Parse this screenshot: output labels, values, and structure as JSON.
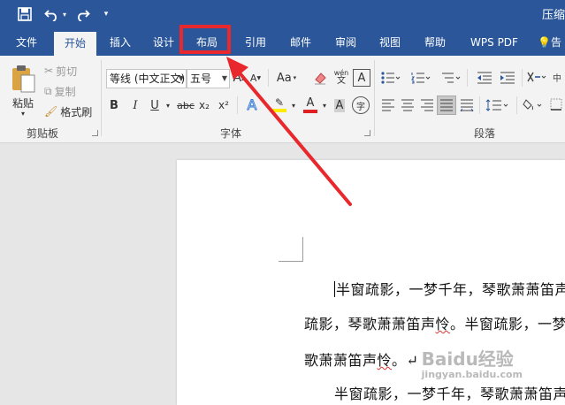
{
  "quick_access": {
    "save_icon": "save-icon",
    "undo_icon": "undo-icon",
    "redo_icon": "redo-icon",
    "customize_icon": "customize-icon"
  },
  "window": {
    "doc_title": "压缩"
  },
  "tabs": [
    {
      "label": "文件"
    },
    {
      "label": "开始"
    },
    {
      "label": "插入"
    },
    {
      "label": "设计"
    },
    {
      "label": "布局"
    },
    {
      "label": "引用"
    },
    {
      "label": "邮件"
    },
    {
      "label": "审阅"
    },
    {
      "label": "视图"
    },
    {
      "label": "帮助"
    },
    {
      "label": "WPS PDF"
    },
    {
      "label": "告"
    }
  ],
  "ribbon": {
    "clipboard": {
      "paste": "粘贴",
      "cut": "剪切",
      "copy": "复制",
      "format_painter": "格式刷",
      "group_label": "剪贴板"
    },
    "font": {
      "font_name": "等线 (中文正文)",
      "font_size": "五号",
      "grow_font": "A",
      "shrink_font": "A",
      "change_case": "Aa",
      "phonetic": "wén",
      "border_char": "A",
      "bold": "B",
      "italic": "I",
      "underline": "U",
      "strike": "abc",
      "subscript": "x₂",
      "superscript": "x²",
      "text_effect": "A",
      "font_color": "A",
      "enclose": "字",
      "group_label": "字体"
    },
    "paragraph": {
      "group_label": "段落"
    }
  },
  "document": {
    "lines": [
      "半窗疏影，一梦千年，琴歌萧萧笛声",
      [
        "疏影，琴歌萧萧笛声",
        {
          "w": "怜"
        },
        "。半窗疏影，一梦"
      ],
      [
        "歌萧萧笛声",
        {
          "w": "怜"
        },
        "。↵"
      ],
      "半窗疏影，一梦千年，琴歌萧萧笛声"
    ]
  },
  "watermark": {
    "text": "Baidu经验",
    "sub": "jingyan.baidu.com"
  },
  "colors": {
    "title_bar": "#2b579a",
    "highlight": "#e8282c",
    "font_color_bar": "#e02020",
    "highlight_bar": "#ffeb00"
  }
}
